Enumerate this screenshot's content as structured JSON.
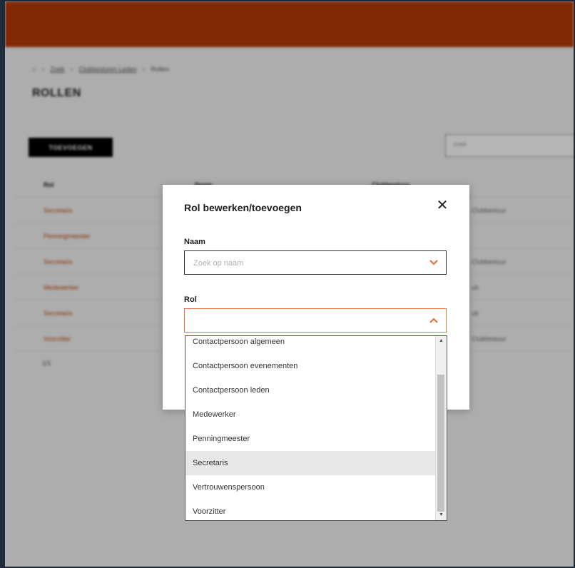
{
  "background": {
    "topbar_color": "#b83a06",
    "breadcrumb": {
      "home": "⌂",
      "items": [
        "Zoek",
        "Clubbesturen Leden",
        "Rollen"
      ]
    },
    "page_title": "ROLLEN",
    "add_button": "TOEVOEGEN",
    "search_placeholder": "zoek",
    "columns": [
      "Rol",
      "Naam",
      "Clubbestuur"
    ],
    "rows": [
      {
        "rol": "Secretaris",
        "naam": "",
        "club": "Clubbestuur"
      },
      {
        "rol": "Penningmeester",
        "naam": "",
        "club": ""
      },
      {
        "rol": "Secretaris",
        "naam": "",
        "club": "Clubbestuur"
      },
      {
        "rol": "Medewerker",
        "naam": "",
        "club": "ub"
      },
      {
        "rol": "Secretaris",
        "naam": "",
        "club": "ub"
      },
      {
        "rol": "Voorzitter",
        "naam": "",
        "club": "Clubbestuur"
      }
    ],
    "pagination": "1/1"
  },
  "modal": {
    "title": "Rol bewerken/toevoegen",
    "close_glyph": "✕",
    "naam_label": "Naam",
    "naam_placeholder": "Zoek op naam",
    "naam_value": "",
    "rol_label": "Rol",
    "rol_value": "",
    "accent_color": "#e8743f"
  },
  "dropdown": {
    "options": [
      "Contactpersoon algemeen",
      "Contactpersoon evenementen",
      "Contactpersoon leden",
      "Medewerker",
      "Penningmeester",
      "Secretaris",
      "Vertrouwenspersoon",
      "Voorzitter"
    ],
    "highlighted": "Secretaris",
    "scroll_up": "▲",
    "scroll_down": "▼"
  }
}
